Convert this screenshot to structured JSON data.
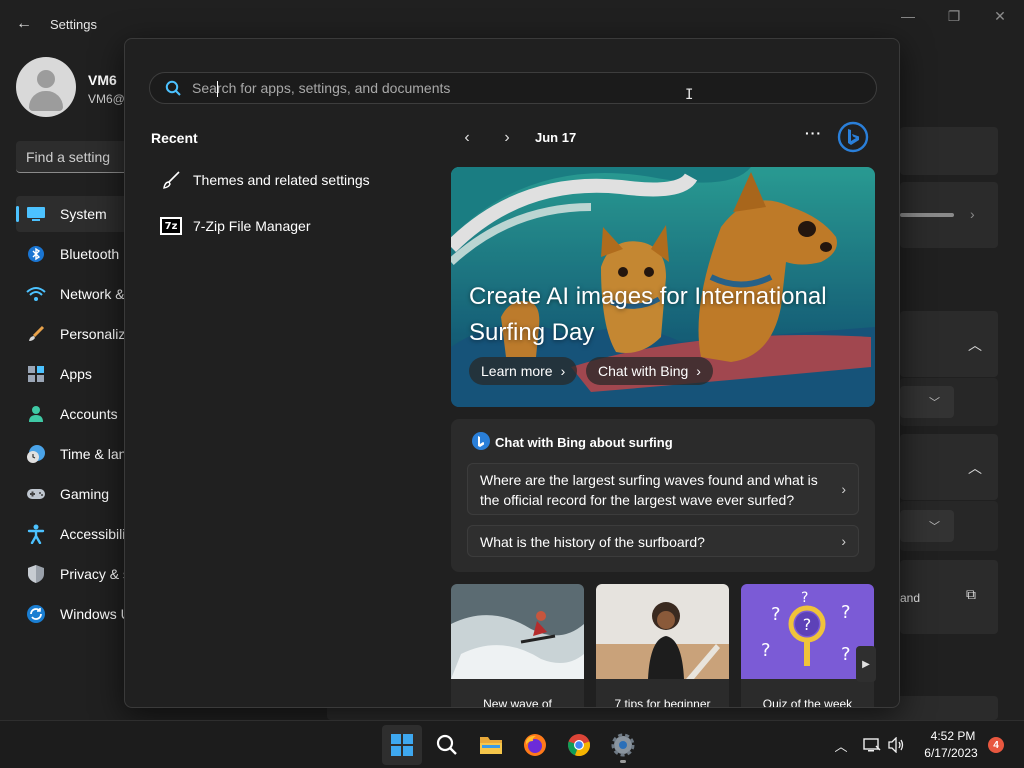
{
  "settings_window": {
    "title": "Settings",
    "back_glyph": "←",
    "min_glyph": "—",
    "max_glyph": "❐",
    "close_glyph": "✕",
    "user": {
      "name": "VM6",
      "email": "VM6@"
    },
    "search_placeholder": "Find a setting",
    "nav": [
      {
        "label": "System",
        "icon": "system-icon",
        "selected": true
      },
      {
        "label": "Bluetooth",
        "icon": "bluetooth-icon"
      },
      {
        "label": "Network &",
        "icon": "network-icon"
      },
      {
        "label": "Personaliz",
        "icon": "personalization-icon"
      },
      {
        "label": "Apps",
        "icon": "apps-icon"
      },
      {
        "label": "Accounts",
        "icon": "accounts-icon"
      },
      {
        "label": "Time & lan",
        "icon": "time-language-icon"
      },
      {
        "label": "Gaming",
        "icon": "gaming-icon"
      },
      {
        "label": "Accessibilit",
        "icon": "accessibility-icon"
      },
      {
        "label": "Privacy & s",
        "icon": "privacy-icon"
      },
      {
        "label": "Windows U",
        "icon": "windows-update-icon"
      }
    ],
    "right_partial_text": "and",
    "chevron_up": "︿",
    "chevron_down": "﹀",
    "chevron_right": "›",
    "external_link_glyph": "⧉",
    "accent_color": "#4cc2ff"
  },
  "start_menu": {
    "search_placeholder": "Search for apps, settings, and documents",
    "search_value": "",
    "ibeam_glyph": "I",
    "recent_title": "Recent",
    "recent_items": [
      {
        "label": "Themes and related settings",
        "icon": "paintbrush-icon"
      },
      {
        "label": "7-Zip File Manager",
        "icon": "7zip-icon",
        "icon_text": "7z"
      }
    ],
    "feed": {
      "prev_glyph": "‹",
      "next_glyph": "›",
      "date": "Jun 17",
      "more_glyph": "···",
      "hero": {
        "title": "Create AI images for International Surfing Day",
        "buttons": [
          {
            "label": "Learn more"
          },
          {
            "label": "Chat with Bing"
          }
        ]
      },
      "chat_card": {
        "title": "Chat with Bing about surfing",
        "questions": [
          "Where are the largest surfing waves found and what is the official record for the largest wave ever surfed?",
          "What is the history of the surfboard?"
        ]
      },
      "news": [
        {
          "title": "New wave of"
        },
        {
          "title": "7 tips for beginner"
        },
        {
          "title": "Quiz of the week"
        }
      ],
      "news_next_glyph": "▶"
    }
  },
  "taskbar": {
    "apps": [
      {
        "name": "start-button"
      },
      {
        "name": "search-button"
      },
      {
        "name": "file-explorer-button"
      },
      {
        "name": "firefox-button"
      },
      {
        "name": "chrome-button"
      },
      {
        "name": "settings-app-button"
      }
    ],
    "tray_chevron": "︿",
    "clock": {
      "time": "4:52 PM",
      "date": "6/17/2023"
    },
    "notification_count": "4"
  }
}
